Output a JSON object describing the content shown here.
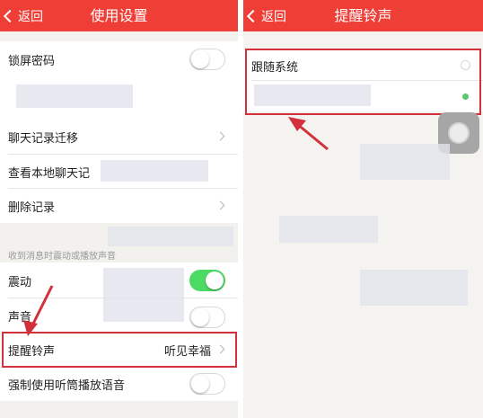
{
  "colors": {
    "nav_red": "#ee3e36",
    "highlight_red": "#d2303a",
    "toggle_green": "#4cd964",
    "radio_green": "#5dc66d"
  },
  "left": {
    "back_label": "返回",
    "title": "使用设置",
    "rows": {
      "lock_password": "锁屏密码",
      "chat_migration": "聊天记录迁移",
      "view_local_chat": "查看本地聊天记",
      "delete_records": "删除记录",
      "vibrate": "震动",
      "sound": "声音",
      "alert_tone": "提醒铃声",
      "force_earpiece": "强制使用听筒播放语音"
    },
    "alert_tone_value": "听见幸福",
    "section_notice": "收到消息时震动或播放声音",
    "toggles": {
      "lock_password": false,
      "vibrate": true,
      "sound": false,
      "force_earpiece": false
    }
  },
  "right": {
    "back_label": "返回",
    "title": "提醒铃声",
    "options": {
      "follow_system": "跟随系统"
    },
    "selected": "second"
  }
}
